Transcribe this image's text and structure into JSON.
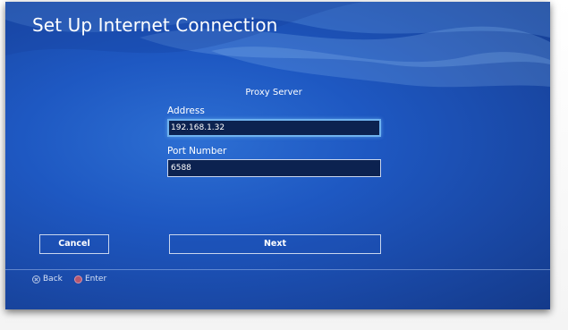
{
  "header": {
    "title": "Set Up Internet Connection"
  },
  "form": {
    "section_title": "Proxy Server",
    "address_label": "Address",
    "address_value": "192.168.1.32",
    "port_label": "Port Number",
    "port_value": "6588"
  },
  "buttons": {
    "cancel_label": "Cancel",
    "next_label": "Next"
  },
  "footer": {
    "back_icon": "cross-button-icon",
    "back_label": "Back",
    "enter_icon": "circle-button-icon",
    "enter_label": "Enter"
  },
  "colors": {
    "background_blue": "#1e58c2",
    "field_background": "#0c2250",
    "focus_highlight": "#6fb2ee"
  }
}
